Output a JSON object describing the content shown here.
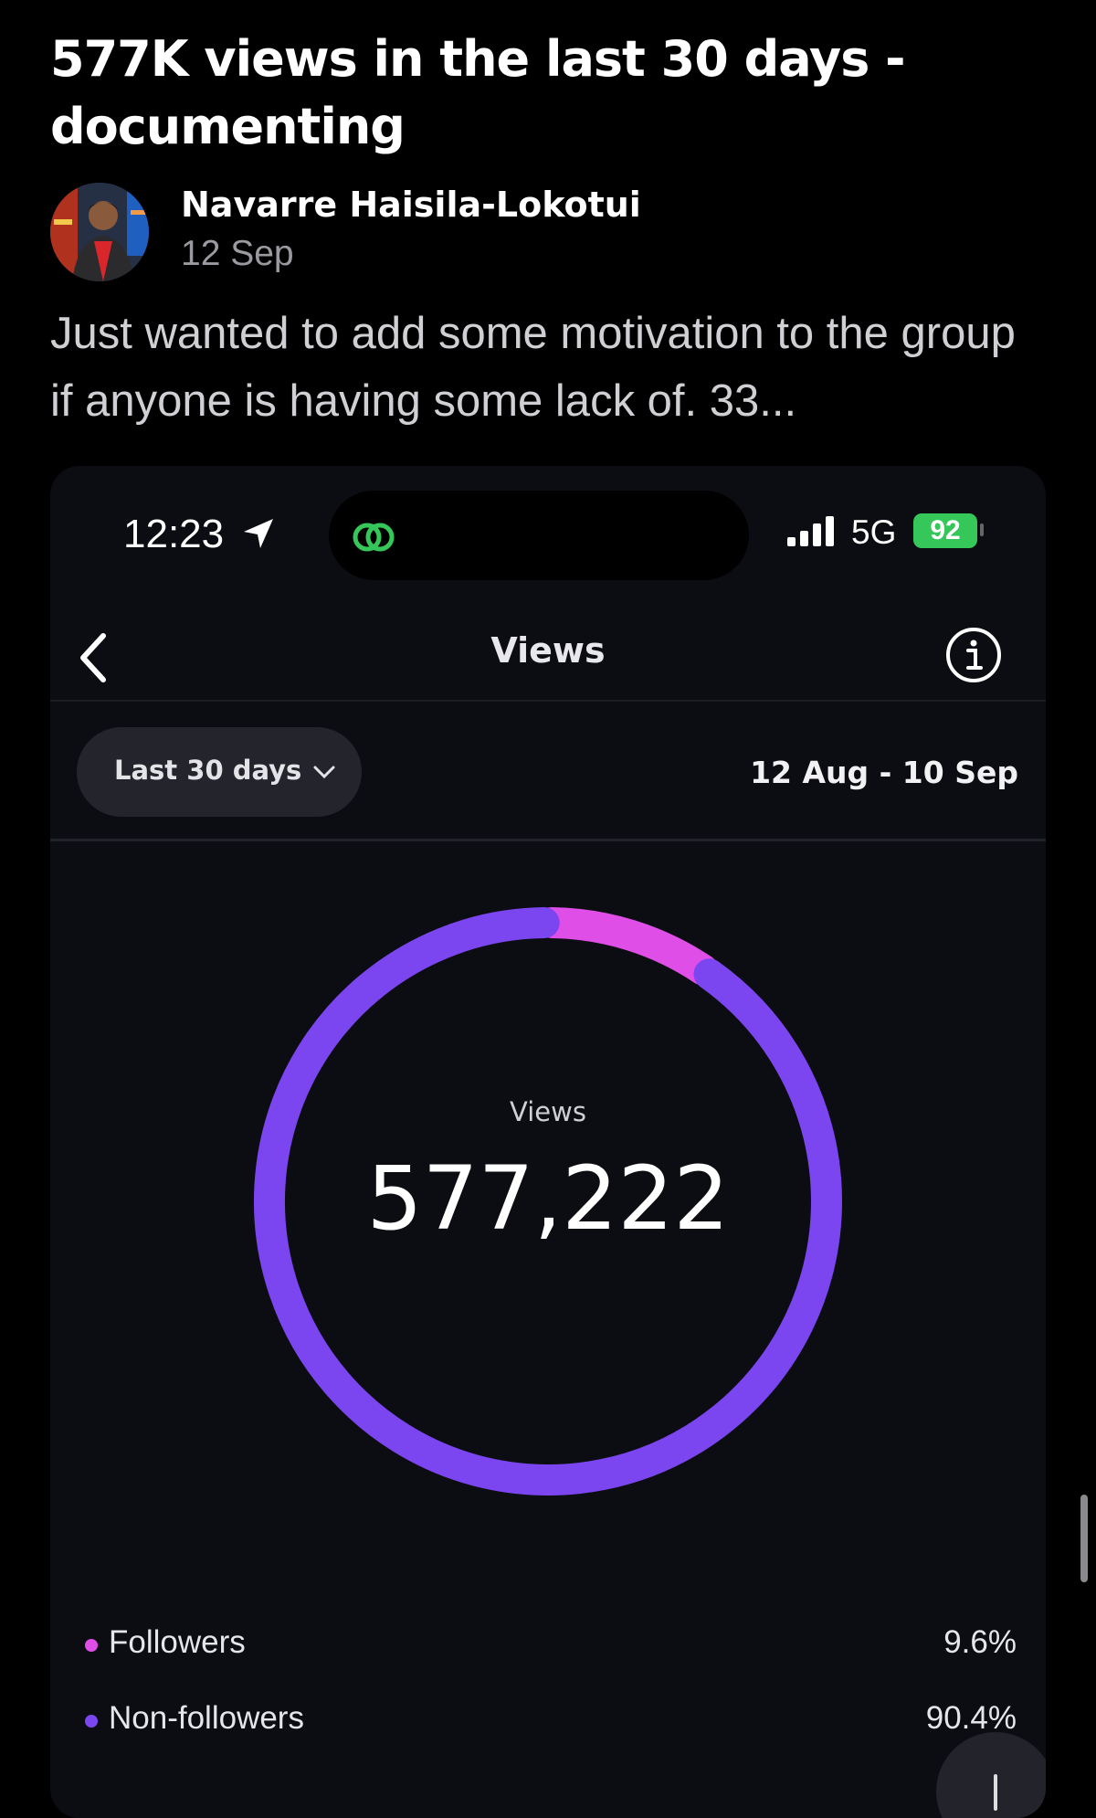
{
  "post": {
    "title": "577K views in the last 30 days - documenting",
    "author": "Navarre Haisila-Lokotui",
    "date": "12 Sep",
    "body": "Just wanted to add some motivation to the group if anyone is having some lack of. 33..."
  },
  "screenshot": {
    "status_bar": {
      "time": "12:23",
      "network": "5G",
      "battery": "92"
    },
    "header": {
      "title": "Views"
    },
    "filter": {
      "range_label": "Last 30 days",
      "date_range": "12 Aug - 10 Sep"
    },
    "summary": {
      "label": "Views",
      "value": "577,222"
    },
    "legend": [
      {
        "label": "Followers",
        "value": "9.6%",
        "color": "#e04ee8"
      },
      {
        "label": "Non-followers",
        "value": "90.4%",
        "color": "#7b45f0"
      }
    ]
  },
  "chart_data": {
    "type": "pie",
    "categories": [
      "Followers",
      "Non-followers"
    ],
    "values": [
      9.6,
      90.4
    ],
    "colors": [
      "#e04ee8",
      "#7b45f0"
    ],
    "title": "",
    "center_label": "Views",
    "center_value": "577,222"
  },
  "icons": [
    "location-arrow-icon",
    "threads-icon",
    "signal-icon",
    "back-chevron-icon",
    "info-icon",
    "chevron-down-icon"
  ]
}
